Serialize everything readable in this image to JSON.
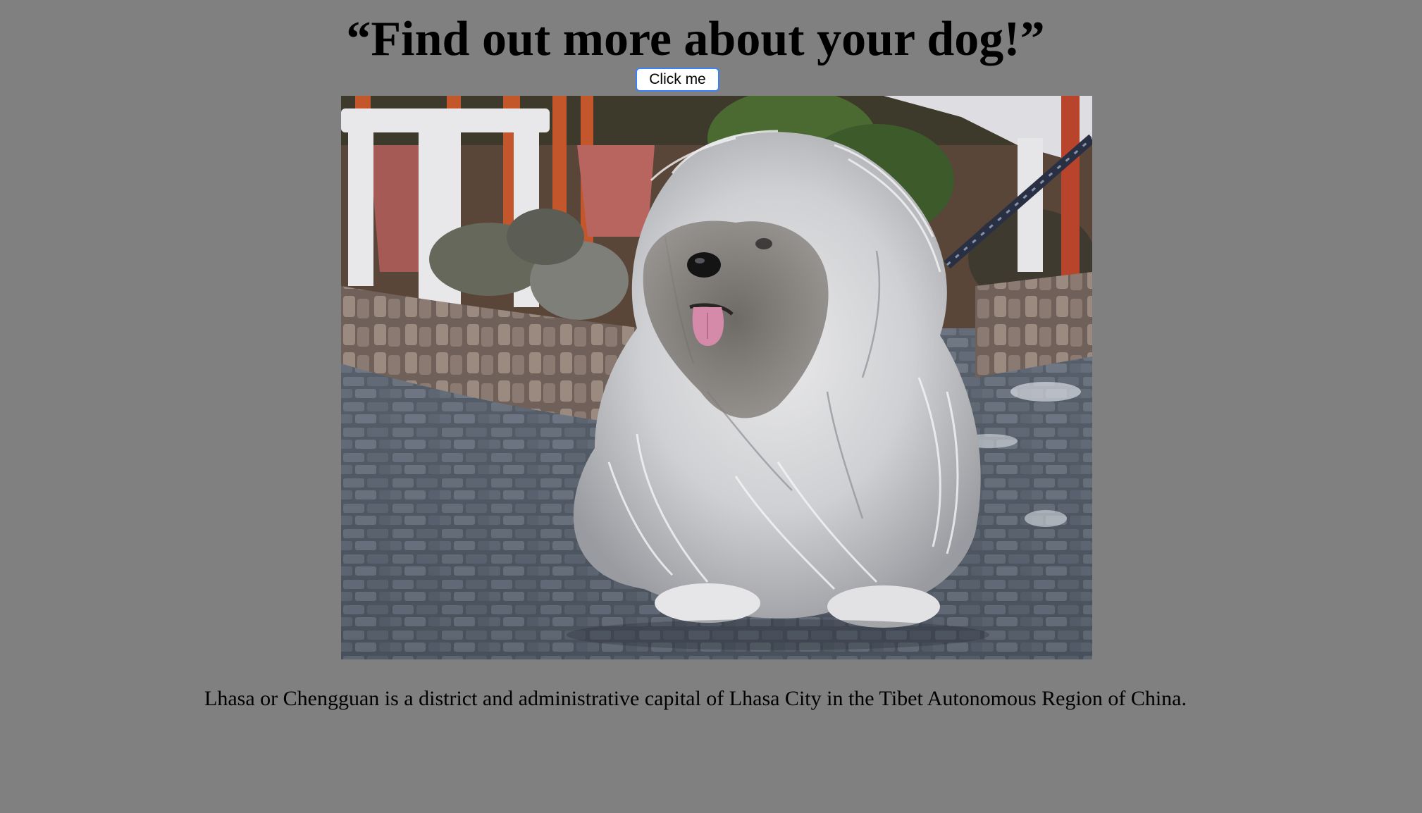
{
  "page": {
    "background": "#808080",
    "title": "“Find out more about your dog!”",
    "button_label": "Click me",
    "image": {
      "icon": "dog-photo",
      "subject": "long-haired grey and white dog sitting on cobblestones"
    },
    "caption": "Lhasa or Chengguan is a district and administrative capital of Lhasa City in the Tibet Autonomous Region of China."
  }
}
